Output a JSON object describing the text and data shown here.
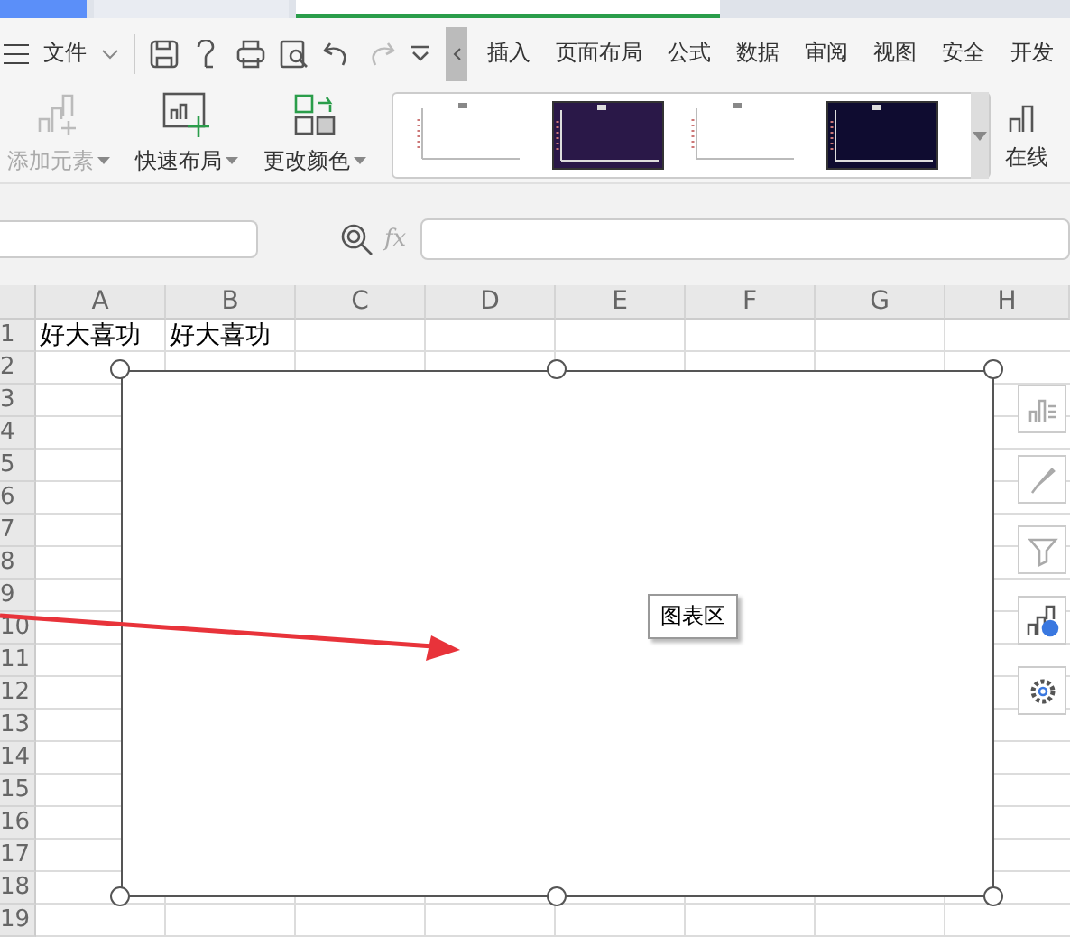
{
  "doc_tabs": [
    {
      "selected": false,
      "kind": "home"
    },
    {
      "selected": false,
      "kind": "template"
    },
    {
      "selected": true,
      "kind": "sheet"
    }
  ],
  "menu": {
    "file": "文件",
    "tabs": [
      "插入",
      "页面布局",
      "公式",
      "数据",
      "审阅",
      "视图",
      "安全",
      "开发"
    ]
  },
  "ribbon": {
    "tools": [
      {
        "label": "添加元素",
        "disabled": true,
        "kind": "add"
      },
      {
        "label": "快速布局",
        "disabled": false,
        "kind": "layout"
      },
      {
        "label": "更改颜色",
        "disabled": false,
        "kind": "color"
      }
    ],
    "styles": [
      {
        "color": "#ffffff"
      },
      {
        "color": "#2a1848"
      },
      {
        "color": "#ffffff"
      },
      {
        "color": "#0f0c30"
      }
    ],
    "online": "在线"
  },
  "formula_bar": {
    "fx": "fx"
  },
  "sheet": {
    "columns": [
      "A",
      "B",
      "C",
      "D",
      "E",
      "F",
      "G",
      "H"
    ],
    "rows": [
      {
        "number": "1",
        "cells": [
          "好大喜功",
          "好大喜功"
        ]
      },
      {
        "number": "2",
        "cells": []
      },
      {
        "number": "3",
        "cells": []
      },
      {
        "number": "4",
        "cells": []
      },
      {
        "number": "5",
        "cells": []
      },
      {
        "number": "6",
        "cells": []
      },
      {
        "number": "7",
        "cells": []
      },
      {
        "number": "8",
        "cells": []
      },
      {
        "number": "9",
        "cells": []
      },
      {
        "number": "10",
        "cells": []
      },
      {
        "number": "11",
        "cells": []
      },
      {
        "number": "12",
        "cells": []
      },
      {
        "number": "13",
        "cells": []
      },
      {
        "number": "14",
        "cells": []
      },
      {
        "number": "15",
        "cells": []
      },
      {
        "number": "16",
        "cells": []
      },
      {
        "number": "17",
        "cells": []
      },
      {
        "number": "18",
        "cells": []
      },
      {
        "number": "19",
        "cells": []
      }
    ]
  },
  "chart": {
    "tooltip": "图表区",
    "side_tools": [
      {
        "kind": "elements"
      },
      {
        "kind": "style"
      },
      {
        "kind": "filter"
      },
      {
        "kind": "online"
      },
      {
        "kind": "settings"
      }
    ]
  }
}
